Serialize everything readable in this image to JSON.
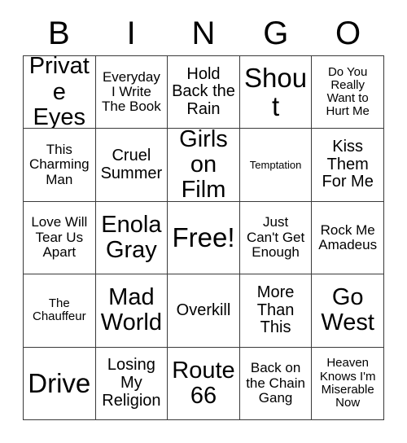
{
  "card": {
    "header_letters": [
      "B",
      "I",
      "N",
      "G",
      "O"
    ],
    "columns": 5,
    "rows": 5,
    "border_color": "#3a3a3a",
    "background_color": "#ffffff",
    "text_color": "#000000",
    "free_space": "Free!",
    "cells": [
      [
        {
          "text": "Private\nEyes",
          "size": "xl"
        },
        {
          "text": "Everyday\nI Write\nThe Book",
          "size": "sm"
        },
        {
          "text": "Hold\nBack the\nRain",
          "size": "md"
        },
        {
          "text": "Shout",
          "size": "xxl"
        },
        {
          "text": "Do You\nReally\nWant to\nHurt Me",
          "size": "xs"
        }
      ],
      [
        {
          "text": "This\nCharming\nMan",
          "size": "sm"
        },
        {
          "text": "Cruel\nSummer",
          "size": "md"
        },
        {
          "text": "Girls\non Film",
          "size": "xl"
        },
        {
          "text": "Temptation",
          "size": "xxs"
        },
        {
          "text": "Kiss\nThem\nFor Me",
          "size": "md"
        }
      ],
      [
        {
          "text": "Love Will\nTear Us\nApart",
          "size": "sm"
        },
        {
          "text": "Enola\nGray",
          "size": "xl"
        },
        {
          "text": "Free!",
          "size": "xxl"
        },
        {
          "text": "Just\nCan't Get\nEnough",
          "size": "sm"
        },
        {
          "text": "Rock Me\nAmadeus",
          "size": "sm"
        }
      ],
      [
        {
          "text": "The\nChauffeur",
          "size": "xs"
        },
        {
          "text": "Mad\nWorld",
          "size": "xl"
        },
        {
          "text": "Overkill",
          "size": "md"
        },
        {
          "text": "More\nThan\nThis",
          "size": "md"
        },
        {
          "text": "Go\nWest",
          "size": "xl"
        }
      ],
      [
        {
          "text": "Drive",
          "size": "xxl"
        },
        {
          "text": "Losing\nMy\nReligion",
          "size": "md"
        },
        {
          "text": "Route\n66",
          "size": "xl"
        },
        {
          "text": "Back on\nthe Chain\nGang",
          "size": "sm"
        },
        {
          "text": "Heaven\nKnows I'm\nMiserable\nNow",
          "size": "xs"
        }
      ]
    ]
  }
}
